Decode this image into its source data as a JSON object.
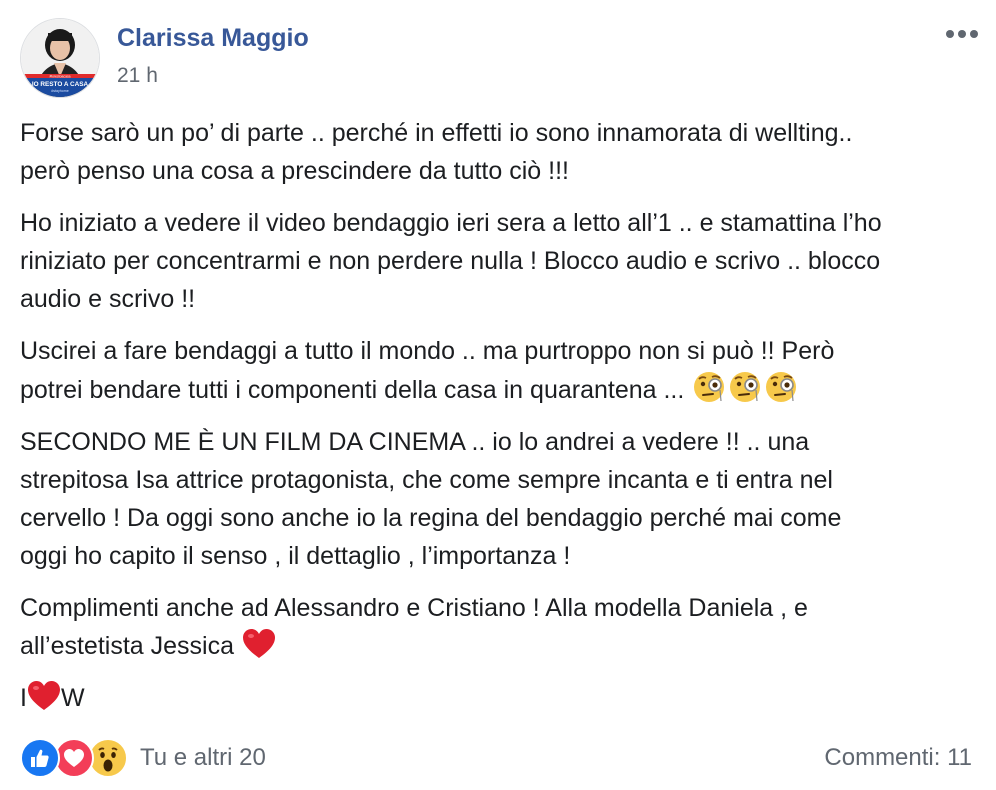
{
  "post": {
    "author": "Clarissa Maggio",
    "timestamp": "21 h",
    "avatar": {
      "badge_top": "#iorestoacasa",
      "badge_main": "IO RESTO A CASA",
      "badge_sub": "#stayhome",
      "colors": {
        "ring": "#1e4fa3",
        "badge_blue": "#1b4ba0",
        "badge_red": "#e02b2b"
      }
    },
    "more_icon": "ellipsis-icon",
    "paragraphs": [
      {
        "lines": [
          "Forse sarò un po’ di parte .. perché in effetti io sono innamorata di wellting..",
          "però penso una cosa a prescindere da tutto ciò !!!"
        ]
      },
      {
        "lines": [
          "Ho iniziato a vedere il video bendaggio ieri sera a letto all’1 .. e stamattina l’ho",
          "riniziato per concentrarmi e non perdere nulla ! Blocco audio e scrivo .. blocco",
          "audio e scrivo !!"
        ]
      },
      {
        "lines": [
          "Uscirei a fare bendaggi a tutto il mondo .. ma purtroppo non si può !! Però",
          "potrei bendare tutti i componenti della casa in quarantena ..."
        ],
        "trailing_emoji": [
          "monocle-face-emoji",
          "monocle-face-emoji",
          "monocle-face-emoji"
        ]
      },
      {
        "lines": [
          "SECONDO ME È UN FILM DA CINEMA .. io lo andrei a vedere !! .. una",
          "strepitosa Isa attrice protagonista, che come sempre incanta e ti entra nel",
          "cervello ! Da oggi sono anche io la regina del bendaggio perché mai come",
          "oggi ho capito il senso , il dettaglio , l’importanza !"
        ]
      },
      {
        "lines": [
          "Complimenti anche ad Alessandro e Cristiano ! Alla modella Daniela , e",
          "all’estetista Jessica"
        ],
        "trailing_emoji": [
          "red-heart-emoji"
        ]
      },
      {
        "lines": [
          "I",
          "W"
        ],
        "inline_heart": true
      }
    ],
    "footer": {
      "reactions": [
        "like-reaction-icon",
        "love-reaction-icon",
        "wow-reaction-icon"
      ],
      "reactions_text": "Tu e altri 20",
      "comments_text": "Commenti: 11"
    },
    "colors": {
      "author_link": "#385898",
      "secondary_text": "#606770",
      "like_blue": "#1877f2",
      "love_red": "#f33e58",
      "wow_yellow": "#f7c94b"
    }
  }
}
